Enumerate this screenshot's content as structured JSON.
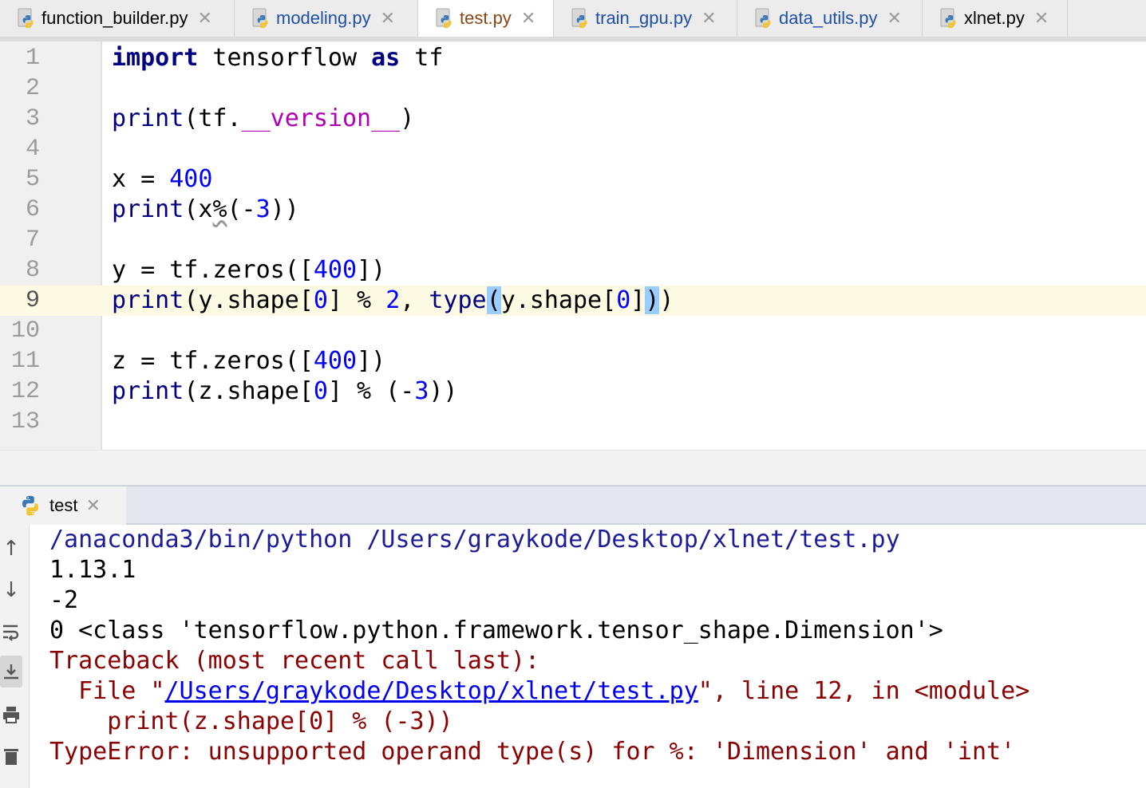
{
  "tabs": [
    {
      "label": "function_builder.py",
      "active": false
    },
    {
      "label": "modeling.py",
      "active": false
    },
    {
      "label": "test.py",
      "active": true
    },
    {
      "label": "train_gpu.py",
      "active": false
    },
    {
      "label": "data_utils.py",
      "active": false
    },
    {
      "label": "xlnet.py",
      "active": false
    }
  ],
  "tab_close": "✕",
  "editor": {
    "current_line": 9,
    "line_numbers": [
      "1",
      "2",
      "3",
      "4",
      "5",
      "6",
      "7",
      "8",
      "9",
      "10",
      "11",
      "12",
      "13"
    ],
    "lines": {
      "l1": {
        "kw_import": "import",
        "sp1": " tensorflow ",
        "kw_as": "as",
        "rest": " tf"
      },
      "l3": {
        "fn": "print",
        "p1": "(tf.",
        "dunder": "__version__",
        "p2": ")"
      },
      "l5": {
        "a": "x = ",
        "n": "400"
      },
      "l6": {
        "fn": "print",
        "a": "(x",
        "pct": "%",
        "b": "(-",
        "n": "3",
        "c": "))"
      },
      "l8": {
        "a": "y = tf.zeros([",
        "n": "400",
        "b": "])"
      },
      "l9": {
        "fn": "print",
        "a": "(y.shape[",
        "n0": "0",
        "b": "] % ",
        "n2": "2",
        "c": ", ",
        "fn2": "type",
        "br1": "(",
        "d": "y.shape[",
        "n3": "0",
        "e": "]",
        "br2": ")",
        "f": ")"
      },
      "l11": {
        "a": "z = tf.zeros([",
        "n": "400",
        "b": "])"
      },
      "l12": {
        "fn": "print",
        "a": "(z.shape[",
        "n0": "0",
        "b": "] % (-",
        "n3": "3",
        "c": "))"
      }
    }
  },
  "run": {
    "tab_label": "test",
    "close": "✕",
    "output": {
      "cmd": "/anaconda3/bin/python /Users/graykode/Desktop/xlnet/test.py",
      "line1": "1.13.1",
      "line2": "-2",
      "line3": "0 <class 'tensorflow.python.framework.tensor_shape.Dimension'>",
      "tb_head": "Traceback (most recent call last):",
      "tb_file_pre": "  File \"",
      "tb_file_link": "/Users/graykode/Desktop/xlnet/test.py",
      "tb_file_post": "\", line 12, in <module>",
      "tb_code": "    print(z.shape[0] % (-3))",
      "tb_error": "TypeError: unsupported operand type(s) for %: 'Dimension' and 'int'"
    },
    "tools": [
      "up-arrow-icon",
      "down-arrow-icon",
      "soft-wrap-icon",
      "scroll-to-end-icon",
      "print-icon",
      "trash-icon"
    ]
  }
}
